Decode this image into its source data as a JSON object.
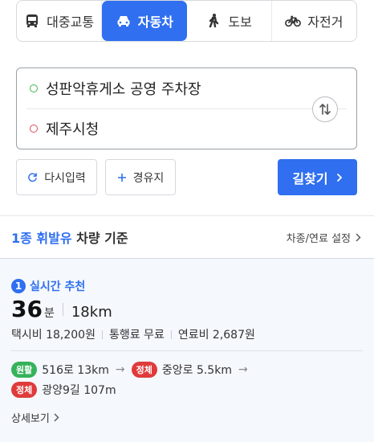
{
  "mode_tabs": [
    {
      "label": "대중교통",
      "icon": "bus-icon"
    },
    {
      "label": "자동차",
      "icon": "car-icon"
    },
    {
      "label": "도보",
      "icon": "walk-icon"
    },
    {
      "label": "자전거",
      "icon": "bicycle-icon"
    }
  ],
  "active_mode": "자동차",
  "route": {
    "origin": "성판악휴게소 공영 주차장",
    "destination": "제주시청"
  },
  "actions": {
    "reset_label": "다시입력",
    "waypoint_label": "경유지",
    "search_label": "길찾기"
  },
  "vehicle": {
    "highlight": "1종 휘발유",
    "title_rest": " 차량 기준",
    "setting_label": "차종/연료 설정"
  },
  "result": {
    "rank": "1",
    "label": "실시간 추천",
    "time_value": "36",
    "time_unit": "분",
    "distance": "18km",
    "taxi_fee": "택시비 18,200원",
    "toll": "통행료 무료",
    "fuel": "연료비 2,687원",
    "roads": [
      {
        "status": "원활",
        "name": "516로 13km"
      },
      {
        "status": "정체",
        "name": "중앙로 5.5km"
      },
      {
        "status": "정체",
        "name": "광양9길 107m"
      }
    ],
    "detail_label": "상세보기"
  },
  "colors": {
    "accent": "#2f6ff0",
    "smooth": "#36b25b",
    "jam": "#e03b3b"
  }
}
